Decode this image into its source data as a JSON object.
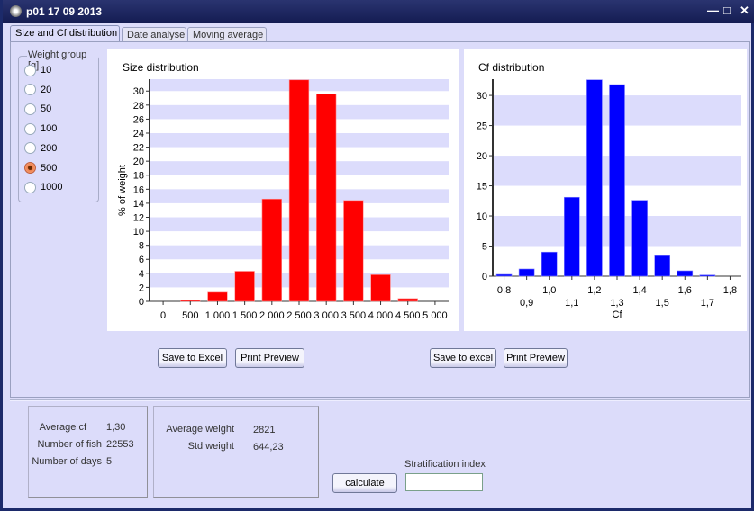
{
  "window": {
    "title": "p01  17 09 2013",
    "controls": [
      "minimize",
      "maximize",
      "close"
    ]
  },
  "tabs": [
    {
      "label": "Size and Cf distribution",
      "active": true
    },
    {
      "label": "Date analyse"
    },
    {
      "label": "Moving average"
    }
  ],
  "weight_group": {
    "label": "Weight group [g]",
    "options": [
      "10",
      "20",
      "50",
      "100",
      "200",
      "500",
      "1000"
    ],
    "selected": "500"
  },
  "buttons": {
    "size_save": "Save to Excel",
    "size_print": "Print Preview",
    "cf_save": "Save to excel",
    "cf_print": "Print Preview",
    "calculate": "calculate"
  },
  "stats": {
    "avg_cf_label": "Average cf",
    "avg_cf": "1,30",
    "fish_label": "Number of fish",
    "fish": "22553",
    "days_label": "Number of days",
    "days": "5",
    "avg_weight_label": "Average weight",
    "avg_weight": "2821",
    "std_weight_label": "Std weight",
    "std_weight": "644,23"
  },
  "stratification": {
    "label": "Stratification index",
    "value": ""
  },
  "chart_data": [
    {
      "type": "bar",
      "title": "Size distribution",
      "xlabel": "",
      "ylabel": "% of weight",
      "categories": [
        "0",
        "500",
        "1 000",
        "1 500",
        "2 000",
        "2 500",
        "3 000",
        "3 500",
        "4 000",
        "4 500",
        "5 000"
      ],
      "values": [
        0,
        0.2,
        1.3,
        4.3,
        14.6,
        31.6,
        29.6,
        14.4,
        3.8,
        0.4,
        0
      ],
      "ylim": [
        0,
        31.7
      ],
      "yticks": [
        0,
        2,
        4,
        6,
        8,
        10,
        12,
        14,
        16,
        18,
        20,
        22,
        24,
        26,
        28,
        30
      ],
      "band_step": 2,
      "color": "#ff0000",
      "band_color": "#dcdcfc"
    },
    {
      "type": "bar",
      "title": "Cf distribution",
      "xlabel": "Cf",
      "ylabel": "",
      "categories": [
        "0,8",
        "0,9",
        "1,0",
        "1,1",
        "1,2",
        "1,3",
        "1,4",
        "1,5",
        "1,6",
        "1,7",
        "1,8"
      ],
      "values": [
        0.3,
        1.2,
        4.0,
        13.1,
        32.6,
        31.8,
        12.6,
        3.4,
        0.9,
        0.2,
        0
      ],
      "ylim": [
        0,
        32.7
      ],
      "yticks": [
        0,
        5,
        10,
        15,
        20,
        25,
        30
      ],
      "band_step": 5,
      "color": "#0000ff",
      "band_color": "#dcdcfc"
    }
  ]
}
